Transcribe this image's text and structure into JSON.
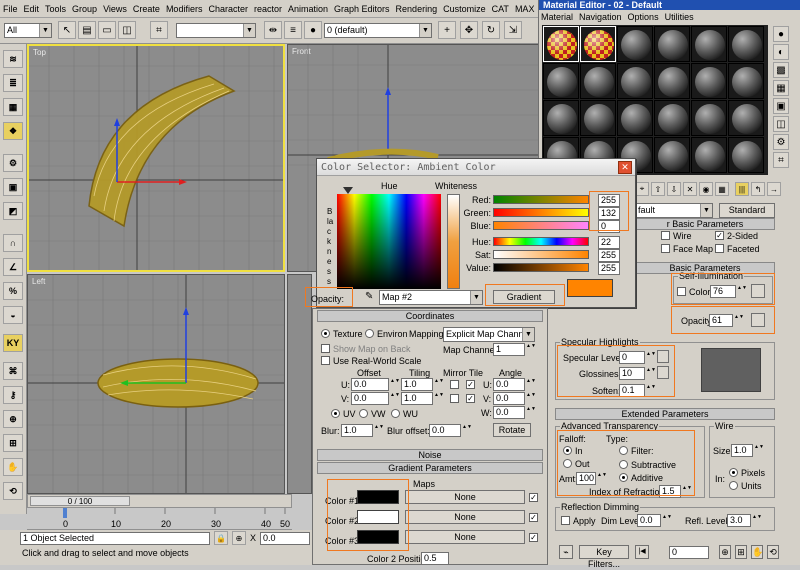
{
  "menubar": [
    "File",
    "Edit",
    "Tools",
    "Group",
    "Views",
    "Create",
    "Modifiers",
    "Character",
    "reactor",
    "Animation",
    "Graph Editors",
    "Rendering",
    "Customize",
    "CAT",
    "MAX"
  ],
  "toolbar": {
    "selection_filter": "All",
    "layer": "0 (default)",
    "ref_coord": "View"
  },
  "viewports": {
    "top": "Top",
    "front": "Front",
    "left": "Left"
  },
  "timeline": {
    "frame": "0 / 100",
    "ticks": [
      "0",
      "10",
      "20",
      "30",
      "40",
      "50"
    ]
  },
  "status": {
    "selection": "1 Object Selected",
    "prompt": "Click and drag to select and move objects",
    "x_label": "X",
    "x_value": "0.0"
  },
  "material_editor": {
    "title": "Material Editor - 02 - Default",
    "menu": [
      "Material",
      "Navigation",
      "Options",
      "Utilities"
    ],
    "material_name": "fault",
    "material_type": "Standard",
    "basic_params_title": "r Basic Parameters",
    "wire": "Wire",
    "two_sided": "2-Sided",
    "face_map": "Face Map",
    "faceted": "Faceted",
    "blinn_title": "Basic Parameters",
    "self_illum": "Self-Illumination",
    "color_label": "Color",
    "color_value": "76",
    "opacity_label": "Opacity:",
    "opacity_value": "61",
    "specular_title": "Specular Highlights",
    "specular_level": "Specular Level:",
    "specular_level_value": "0",
    "glossiness": "Glossiness:",
    "glossiness_value": "10",
    "soften": "Soften:",
    "soften_value": "0.1",
    "extended_title": "Extended Parameters",
    "adv_transparency": "Advanced Transparency",
    "falloff": "Falloff:",
    "type": "Type:",
    "in": "In",
    "out": "Out",
    "filter": "Filter:",
    "subtractive": "Subtractive",
    "additive": "Additive",
    "amt": "Amt:",
    "amt_value": "100",
    "ior": "Index of Refraction:",
    "ior_value": "1.5",
    "wire_group": "Wire",
    "size": "Size:",
    "size_value": "1.0",
    "in_label": "In:",
    "pixels": "Pixels",
    "units": "Units",
    "reflection_dimming": "Reflection Dimming",
    "apply": "Apply",
    "dim_level": "Dim Level:",
    "dim_value": "0.0",
    "refl_level": "Refl. Level:",
    "refl_value": "3.0",
    "key_filters": "Key Filters...",
    "key_value": "0"
  },
  "color_dialog": {
    "title": "Color Selector: Ambient Color",
    "hue": "Hue",
    "whiteness": "Whiteness",
    "blackness": "Blackness",
    "red": "Red:",
    "red_value": "255",
    "green": "Green:",
    "green_value": "132",
    "blue": "Blue:",
    "blue_value": "0",
    "hue_label": "Hue:",
    "hue_value": "22",
    "sat": "Sat:",
    "sat_value": "255",
    "value": "Value:",
    "value_value": "255",
    "opacity": "Opacity:",
    "map": "Map #2",
    "gradient": "Gradient",
    "swatch_color": "#ff8400"
  },
  "map_params": {
    "coordinates": "Coordinates",
    "texture": "Texture",
    "environ": "Environ",
    "mapping": "Mapping:",
    "mapping_value": "Explicit Map Channel",
    "show_map": "Show Map on Back",
    "map_channel": "Map Channel:",
    "map_channel_value": "1",
    "real_world": "Use Real-World Scale",
    "offset": "Offset",
    "tiling": "Tiling",
    "mirror_tile": "Mirror Tile",
    "angle": "Angle",
    "u": "U:",
    "v": "V:",
    "w": "W:",
    "u_offset": "0.0",
    "v_offset": "0.0",
    "u_tiling": "1.0",
    "v_tiling": "1.0",
    "u_angle": "0.0",
    "v_angle": "0.0",
    "w_angle": "0.0",
    "uv": "UV",
    "vw": "VW",
    "wu": "WU",
    "blur": "Blur:",
    "blur_value": "1.0",
    "blur_offset": "Blur offset:",
    "blur_offset_value": "0.0",
    "rotate": "Rotate",
    "noise": "Noise",
    "gradient_params": "Gradient Parameters",
    "maps": "Maps",
    "color1": "Color #1",
    "color2": "Color #2",
    "color3": "Color #3",
    "none": "None",
    "color2_pos": "Color 2 Position:",
    "color2_pos_value": "0.5"
  }
}
